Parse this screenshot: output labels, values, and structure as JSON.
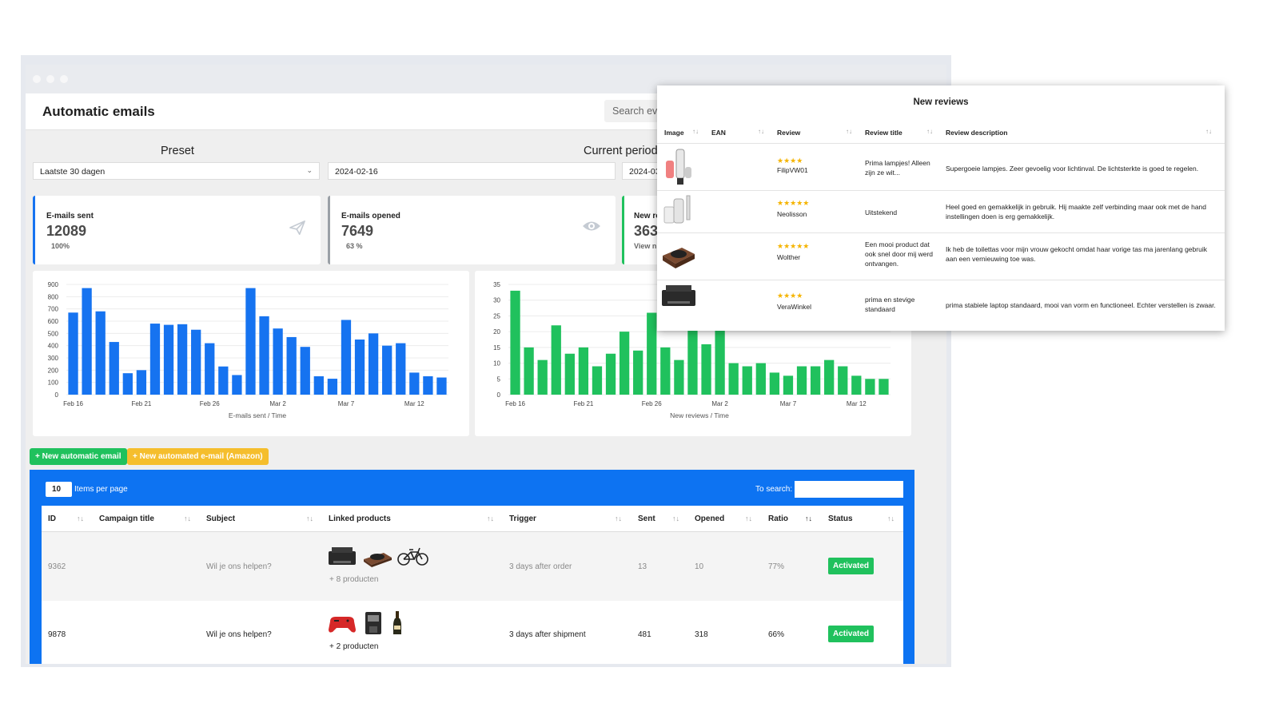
{
  "app": {
    "title": "Automatic emails",
    "search_placeholder": "Search every"
  },
  "filters": {
    "preset_label": "Preset",
    "preset_value": "Laatste 30 dagen",
    "period_label": "Current period",
    "date_from": "2024-02-16",
    "date_to": "2024-03"
  },
  "stats": [
    {
      "label": "E-mails sent",
      "value": "12089",
      "sub": "100%",
      "icon": "paper-plane-icon",
      "color": "#1673f0"
    },
    {
      "label": "E-mails opened",
      "value": "7649",
      "sub": "63 %",
      "icon": "eye-icon",
      "color": "#9aa0a6"
    },
    {
      "label": "New re",
      "value": "363",
      "sub": "View n",
      "icon": "",
      "color": "#20c15d"
    }
  ],
  "chart_data": [
    {
      "type": "bar",
      "title": "",
      "xlabel": "E-mails sent / Time",
      "ylabel": "",
      "ylim": [
        0,
        900
      ],
      "yticks": [
        0,
        100,
        200,
        300,
        400,
        500,
        600,
        700,
        800,
        900
      ],
      "x_tick_labels": [
        "Feb 16",
        "Feb 21",
        "Feb 26",
        "Mar 2",
        "Mar 7",
        "Mar 12"
      ],
      "categories": [
        "Feb 16",
        "Feb 17",
        "Feb 18",
        "Feb 19",
        "Feb 20",
        "Feb 21",
        "Feb 22",
        "Feb 23",
        "Feb 24",
        "Feb 25",
        "Feb 26",
        "Feb 27",
        "Feb 28",
        "Feb 29",
        "Mar 1",
        "Mar 2",
        "Mar 3",
        "Mar 4",
        "Mar 5",
        "Mar 6",
        "Mar 7",
        "Mar 8",
        "Mar 9",
        "Mar 10",
        "Mar 11",
        "Mar 12",
        "Mar 13",
        "Mar 14"
      ],
      "values": [
        670,
        870,
        680,
        430,
        175,
        200,
        580,
        570,
        575,
        530,
        420,
        230,
        160,
        870,
        640,
        540,
        470,
        390,
        150,
        130,
        610,
        450,
        500,
        400,
        420,
        180,
        150,
        140
      ],
      "color": "#1673f0",
      "grid": true
    },
    {
      "type": "bar",
      "title": "",
      "xlabel": "New reviews / Time",
      "ylabel": "",
      "ylim": [
        0,
        35
      ],
      "yticks": [
        0,
        5,
        10,
        15,
        20,
        25,
        30,
        35
      ],
      "x_tick_labels": [
        "Feb 16",
        "Feb 21",
        "Feb 26",
        "Mar 2",
        "Mar 7",
        "Mar 12"
      ],
      "categories": [
        "Feb 16",
        "Feb 17",
        "Feb 18",
        "Feb 19",
        "Feb 20",
        "Feb 21",
        "Feb 22",
        "Feb 23",
        "Feb 24",
        "Feb 25",
        "Feb 26",
        "Feb 27",
        "Feb 28",
        "Feb 29",
        "Mar 1",
        "Mar 2",
        "Mar 3",
        "Mar 4",
        "Mar 5",
        "Mar 6",
        "Mar 7",
        "Mar 8",
        "Mar 9",
        "Mar 10",
        "Mar 11",
        "Mar 12",
        "Mar 13",
        "Mar 14"
      ],
      "values": [
        33,
        15,
        11,
        22,
        13,
        15,
        9,
        13,
        20,
        14,
        26,
        15,
        11,
        26,
        16,
        25,
        10,
        9,
        10,
        7,
        6,
        9,
        9,
        11,
        9,
        6,
        5,
        5
      ],
      "color": "#20c15d",
      "grid": true
    }
  ],
  "buttons": {
    "new_email": "+ New automatic email",
    "new_amazon": "+ New automated e-mail (Amazon)"
  },
  "table": {
    "items_per_page": "10",
    "items_per_page_label": "Items per page",
    "search_label": "To search:",
    "columns": [
      "ID",
      "Campaign title",
      "Subject",
      "Linked products",
      "Trigger",
      "Sent",
      "Opened",
      "Ratio",
      "Status"
    ],
    "rows": [
      {
        "id": "9362",
        "campaign": "",
        "subject": "Wil je ons helpen?",
        "products_more": "+ 8 producten",
        "trigger": "3 days after order",
        "sent": "13",
        "opened": "10",
        "ratio": "77%",
        "status": "Activated"
      },
      {
        "id": "9878",
        "campaign": "",
        "subject": "Wil je ons helpen?",
        "products_more": "+ 2 producten",
        "trigger": "3 days after shipment",
        "sent": "481",
        "opened": "318",
        "ratio": "66%",
        "status": "Activated"
      }
    ]
  },
  "reviews": {
    "title": "New reviews",
    "columns": [
      "Image",
      "EAN",
      "Review",
      "Review title",
      "Review description"
    ],
    "rows": [
      {
        "stars": "★★★★",
        "user": "FilipVW01",
        "title": "Prima lampjes! Alleen zijn ze wit...",
        "description": "Supergoeie lampjes. Zeer gevoelig voor lichtinval. De lichtsterkte is goed te regelen."
      },
      {
        "stars": "★★★★★",
        "user": "Neolisson",
        "title": "Uitstekend",
        "description": "Heel goed en gemakkelijk in gebruik. Hij maakte zelf verbinding maar ook met de hand instellingen doen is erg gemakkelijk."
      },
      {
        "stars": "★★★★★",
        "user": "Wolther",
        "title": "Een mooi product dat ook snel door mij werd ontvangen.",
        "description": "Ik heb de toilettas voor mijn vrouw gekocht omdat haar vorige tas ma jarenlang gebruik aan een vernieuwing toe was."
      },
      {
        "stars": "★★★★",
        "user": "VeraWinkel",
        "title": "prima en stevige standaard",
        "description": "prima stabiele laptop standaard, mooi van vorm en functioneel. Echter verstellen is zwaar."
      }
    ]
  }
}
